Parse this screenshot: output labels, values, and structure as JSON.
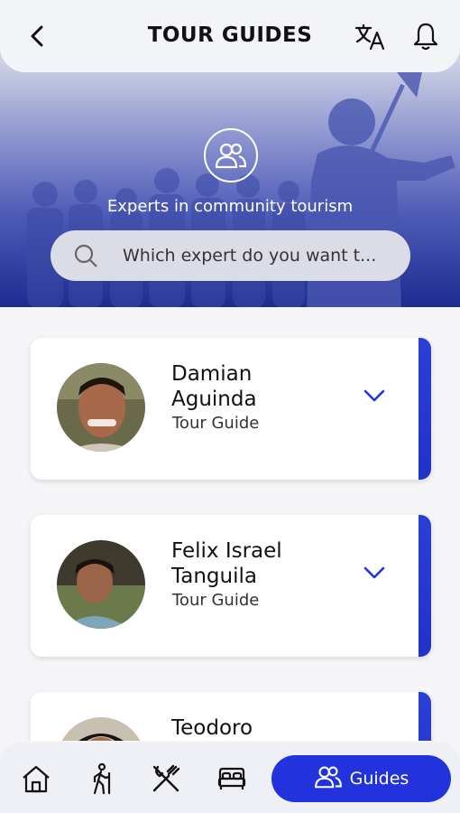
{
  "header": {
    "title": "TOUR GUIDES",
    "back_icon": "back-arrow-icon",
    "translate_icon": "translate-icon",
    "notifications_icon": "bell-icon"
  },
  "hero": {
    "icon": "group-icon",
    "subtitle": "Experts in community tourism"
  },
  "search": {
    "placeholder": "Which expert do you want t...",
    "value": ""
  },
  "guides": [
    {
      "name_line1": "Damian",
      "name_line2": "Aguinda",
      "role": "Tour Guide"
    },
    {
      "name_line1": "Felix Israel",
      "name_line2": "Tanguila",
      "role": "Tour Guide"
    },
    {
      "name_line1": "Teodoro",
      "name_line2": "",
      "role": ""
    }
  ],
  "nav": {
    "items": [
      "home-icon",
      "hiking-icon",
      "restaurant-icon",
      "bed-icon"
    ],
    "active_label": "Guides",
    "active_icon": "group-icon"
  },
  "colors": {
    "accent": "#2233dd",
    "hero_dark": "#1d2c8f",
    "header_bg": "#f3f4f8"
  }
}
